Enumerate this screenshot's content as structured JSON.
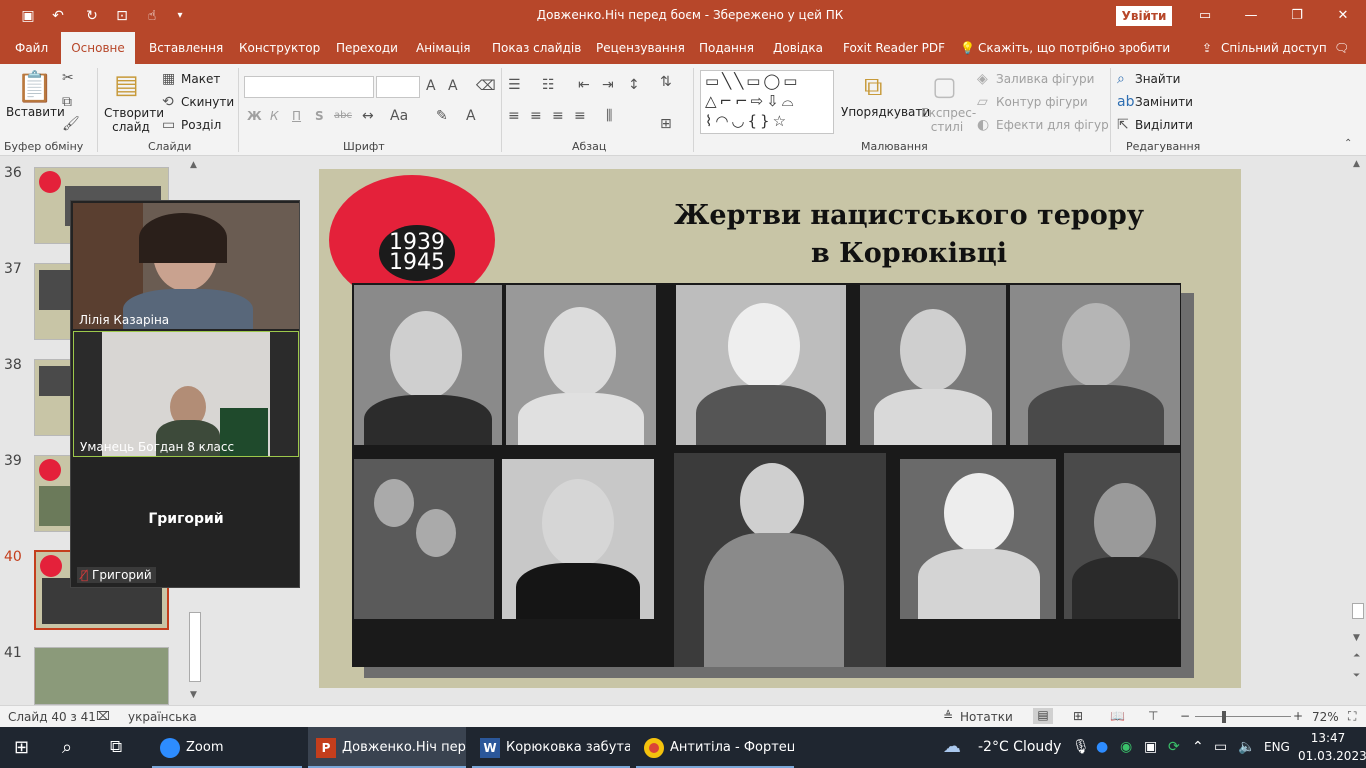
{
  "titlebar": {
    "doc_title": "Довженко.Ніч перед боєм  -  Збережено у цей ПК",
    "signin": "Увійти"
  },
  "tabs": [
    {
      "label": "Файл"
    },
    {
      "label": "Основне"
    },
    {
      "label": "Вставлення"
    },
    {
      "label": "Конструктор"
    },
    {
      "label": "Переходи"
    },
    {
      "label": "Анімація"
    },
    {
      "label": "Показ слайдів"
    },
    {
      "label": "Рецензування"
    },
    {
      "label": "Подання"
    },
    {
      "label": "Довідка"
    },
    {
      "label": "Foxit Reader PDF"
    },
    {
      "label": "Скажіть, що потрібно зробити"
    },
    {
      "label": "Спільний доступ"
    }
  ],
  "ribbon": {
    "clipboard": {
      "paste": "Вставити",
      "label": "Буфер обміну"
    },
    "slides": {
      "new_slide": "Створити слайд",
      "layout": "Макет",
      "reset": "Скинути",
      "section": "Розділ",
      "label": "Слайди"
    },
    "font": {
      "bold": "Ж",
      "italic": "К",
      "underline": "П",
      "shadow": "S",
      "strike": "abc",
      "label": "Шрифт"
    },
    "paragraph": {
      "label": "Абзац"
    },
    "drawing": {
      "arrange": "Упорядкувати",
      "quick_styles": "Експрес-стилі",
      "fill": "Заливка фігури",
      "outline": "Контур фігури",
      "effects": "Ефекти для фігур",
      "label": "Малювання"
    },
    "editing": {
      "find": "Знайти",
      "replace": "Замінити",
      "select": "Виділити",
      "label": "Редагування"
    }
  },
  "slide_numbers": [
    "36",
    "37",
    "38",
    "39",
    "40",
    "41"
  ],
  "zoom": {
    "participants": [
      {
        "name": "Лілія Казаріна"
      },
      {
        "name": "Уманець Богдан 8 класс"
      },
      {
        "name": "Григорий"
      }
    ],
    "muted_label": "Григорий"
  },
  "slide": {
    "badge": {
      "year1": "1939",
      "year2": "1945"
    },
    "title_line1": "Жертви нацистського терору",
    "title_line2": "в Корюківці"
  },
  "status": {
    "slide_info": "Слайд 40 з 41",
    "language": "українська",
    "notes": "Нотатки",
    "zoom": "72%"
  },
  "taskbar": {
    "items": [
      {
        "label": "Zoom"
      },
      {
        "label": "Довженко.Ніч пер..."
      },
      {
        "label": "Корюковка забута ..."
      },
      {
        "label": "Антитіла - Фортец..."
      }
    ],
    "weather": "-2°C  Cloudy",
    "lang": "ENG",
    "time": "13:47",
    "date": "01.03.2023"
  }
}
